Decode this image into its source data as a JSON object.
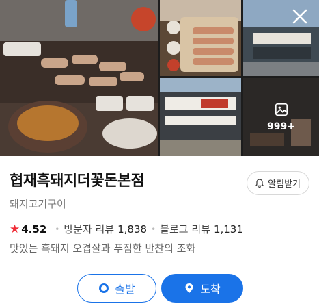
{
  "gallery": {
    "more_count": "999+",
    "photo_main_alt": "",
    "photos": [
      "main",
      "a",
      "b",
      "c",
      "d"
    ]
  },
  "place": {
    "name": "협재흑돼지더꽃돈본점",
    "category": "돼지고기구이",
    "alarm_label": "알림받기",
    "rating": "4.52",
    "visitor_review_label": "방문자 리뷰",
    "visitor_review_count": "1,838",
    "blog_review_label": "블로그 리뷰",
    "blog_review_count": "1,131",
    "description": "맛있는 흑돼지 오겹살과 푸짐한 반찬의 조화"
  },
  "actions": {
    "origin_label": "출발",
    "destination_label": "도착"
  },
  "colors": {
    "accent": "#1a73e8",
    "star": "#f02d37"
  },
  "icons": {
    "close": "close-icon",
    "bell": "bell-icon",
    "gallery": "gallery-icon",
    "origin": "origin-dot-icon",
    "destination": "location-pin-icon",
    "star": "star-icon"
  }
}
